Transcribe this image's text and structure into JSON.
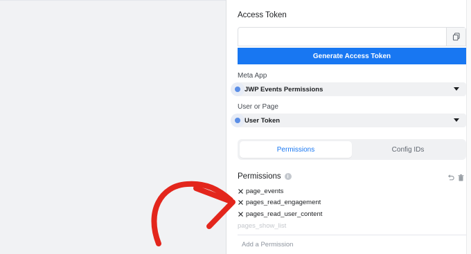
{
  "access_token": {
    "title": "Access Token",
    "value": "",
    "copy_icon": "copy-icon",
    "generate_label": "Generate Access Token"
  },
  "meta_app": {
    "label": "Meta App",
    "selected": "JWP Events Permissions"
  },
  "user_or_page": {
    "label": "User or Page",
    "selected": "User Token"
  },
  "tabs": [
    {
      "label": "Permissions",
      "active": true
    },
    {
      "label": "Config IDs",
      "active": false
    }
  ],
  "permissions": {
    "title": "Permissions",
    "info_glyph": "i",
    "items": [
      "page_events",
      "pages_read_engagement",
      "pages_read_user_content"
    ],
    "suggestion": "pages_show_list",
    "add_placeholder": "Add a Permission"
  },
  "colors": {
    "accent": "#1877f2",
    "annotation_arrow": "#e3261c",
    "indicator_dot": "#5b8ee6"
  }
}
